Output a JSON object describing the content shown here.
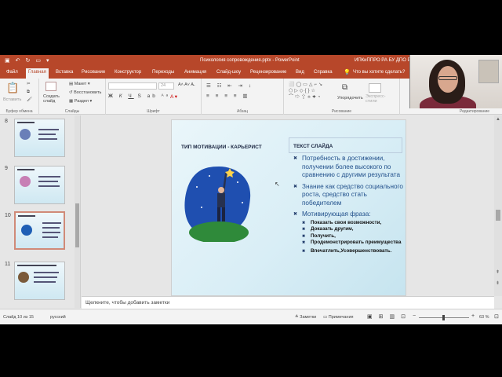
{
  "titlebar": {
    "doc_title": "Психология сопровождения.pptx  -  PowerPoint",
    "org": "ИПКиППРО РА БУ ДПО РА"
  },
  "tabs": [
    "Файл",
    "Главная",
    "Вставка",
    "Рисование",
    "Конструктор",
    "Переходы",
    "Анимация",
    "Слайд-шоу",
    "Рецензирование",
    "Вид",
    "Справка"
  ],
  "tell_me": "Что вы хотите сделать?",
  "ribbon": {
    "paste": "Вставить",
    "create_slide": "Создать\nслайд",
    "layout": "Макет",
    "reset": "Восстановить",
    "section": "Раздел",
    "font_size": "24",
    "arrange": "Упорядочить",
    "quick_styles": "Экспресс-\nстили",
    "groups": [
      "Буфер обмена",
      "Слайды",
      "Шрифт",
      "Абзац",
      "Рисование",
      "Редактирование"
    ]
  },
  "slide_numbers": [
    "8",
    "9",
    "10",
    "11"
  ],
  "slide": {
    "title": "ТИП МОТИВАЦИИ - КАРЬЕРИСТ",
    "text_header": "ТЕКСТ СЛАЙДА",
    "bullets": [
      "Потребность в достижении, получении более высокого по сравнению с другими результата",
      "Знание как средство социального роста, средство стать победителем",
      "Мотивирующая фраза:"
    ],
    "sub_bullets": [
      "Показать свои возможности,",
      "Доказать другим,",
      "Получить,",
      "Продемонстрировать преимущества",
      "Впечатлить,Усовершенствовать."
    ]
  },
  "notes_placeholder": "Щелкните, чтобы добавить заметки",
  "status": {
    "slide_of": "Слайд 10 из 15",
    "language": "русский",
    "notes": "Заметки",
    "comments": "Примечания",
    "zoom": "63 %"
  },
  "colors": {
    "accent": "#b7472a",
    "ribbon": "#f3f3f3"
  }
}
